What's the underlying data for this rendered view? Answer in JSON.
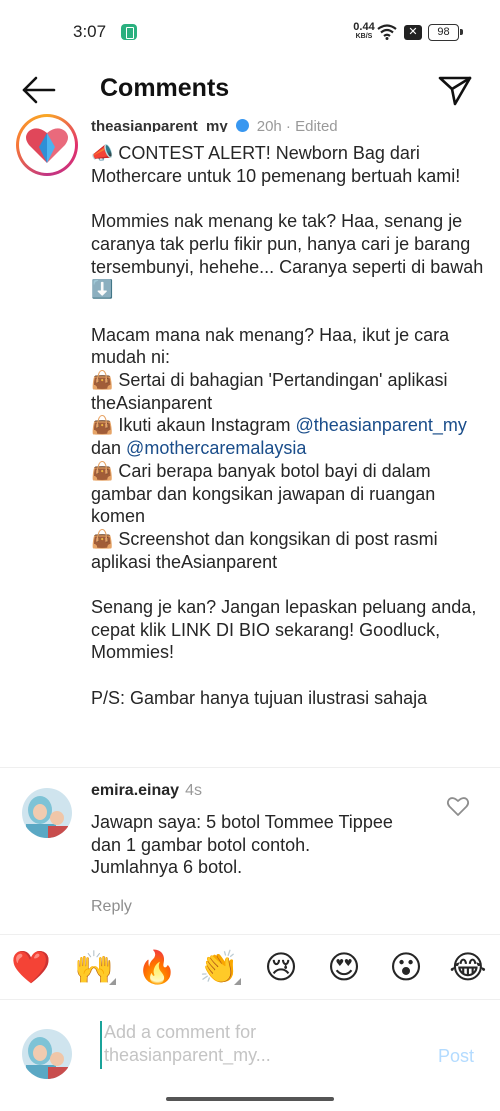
{
  "status_bar": {
    "time": "3:07",
    "net_speed_value": "0.44",
    "net_speed_unit": "KB/S",
    "battery": "98"
  },
  "header": {
    "title": "Comments"
  },
  "caption": {
    "username": "theasianparent_my",
    "time": "20h",
    "edited": "Edited",
    "text_before_mention_1": "📣 CONTEST ALERT! Newborn Bag dari Mothercare untuk 10 pemenang bertuah kami!\n\nMommies nak menang ke tak? Haa, senang je caranya tak perlu fikir pun, hanya cari je barang tersembunyi, hehehe... Caranya seperti di bawah ⬇️\n\nMacam mana nak menang? Haa, ikut je cara mudah ni:\n👜 Sertai di bahagian 'Pertandingan' aplikasi theAsianparent\n👜 Ikuti akaun Instagram ",
    "mention_1": "@theasianparent_my",
    "text_between_mentions": " dan ",
    "mention_2": "@mothercaremalaysia",
    "text_after_mention_2": "\n👜 Cari berapa banyak botol bayi di dalam gambar dan kongsikan jawapan di ruangan komen\n👜 Screenshot dan kongsikan di post rasmi aplikasi theAsianparent\n\nSenang je kan? Jangan lepaskan peluang anda, cepat klik LINK DI BIO sekarang! Goodluck, Mommies!\n\nP/S: Gambar hanya tujuan ilustrasi sahaja"
  },
  "comment": {
    "username": "emira.einay",
    "time": "4s",
    "text": "Jawapn saya: 5 botol Tommee Tippee dan 1 gambar botol contoh. Jumlahnya 6 botol.",
    "reply_label": "Reply"
  },
  "emoji_bar": {
    "items": [
      "❤️",
      "🙌",
      "🔥",
      "👏",
      "😢",
      "😍",
      "😮",
      "😂"
    ]
  },
  "composer": {
    "placeholder": "Add a comment for theasianparent_my...",
    "value": "",
    "post_label": "Post"
  },
  "colors": {
    "mention": "#1a4d8a",
    "post_disabled": "#b3dbff",
    "cursor": "#1aa39a",
    "verified": "#3897f0"
  }
}
